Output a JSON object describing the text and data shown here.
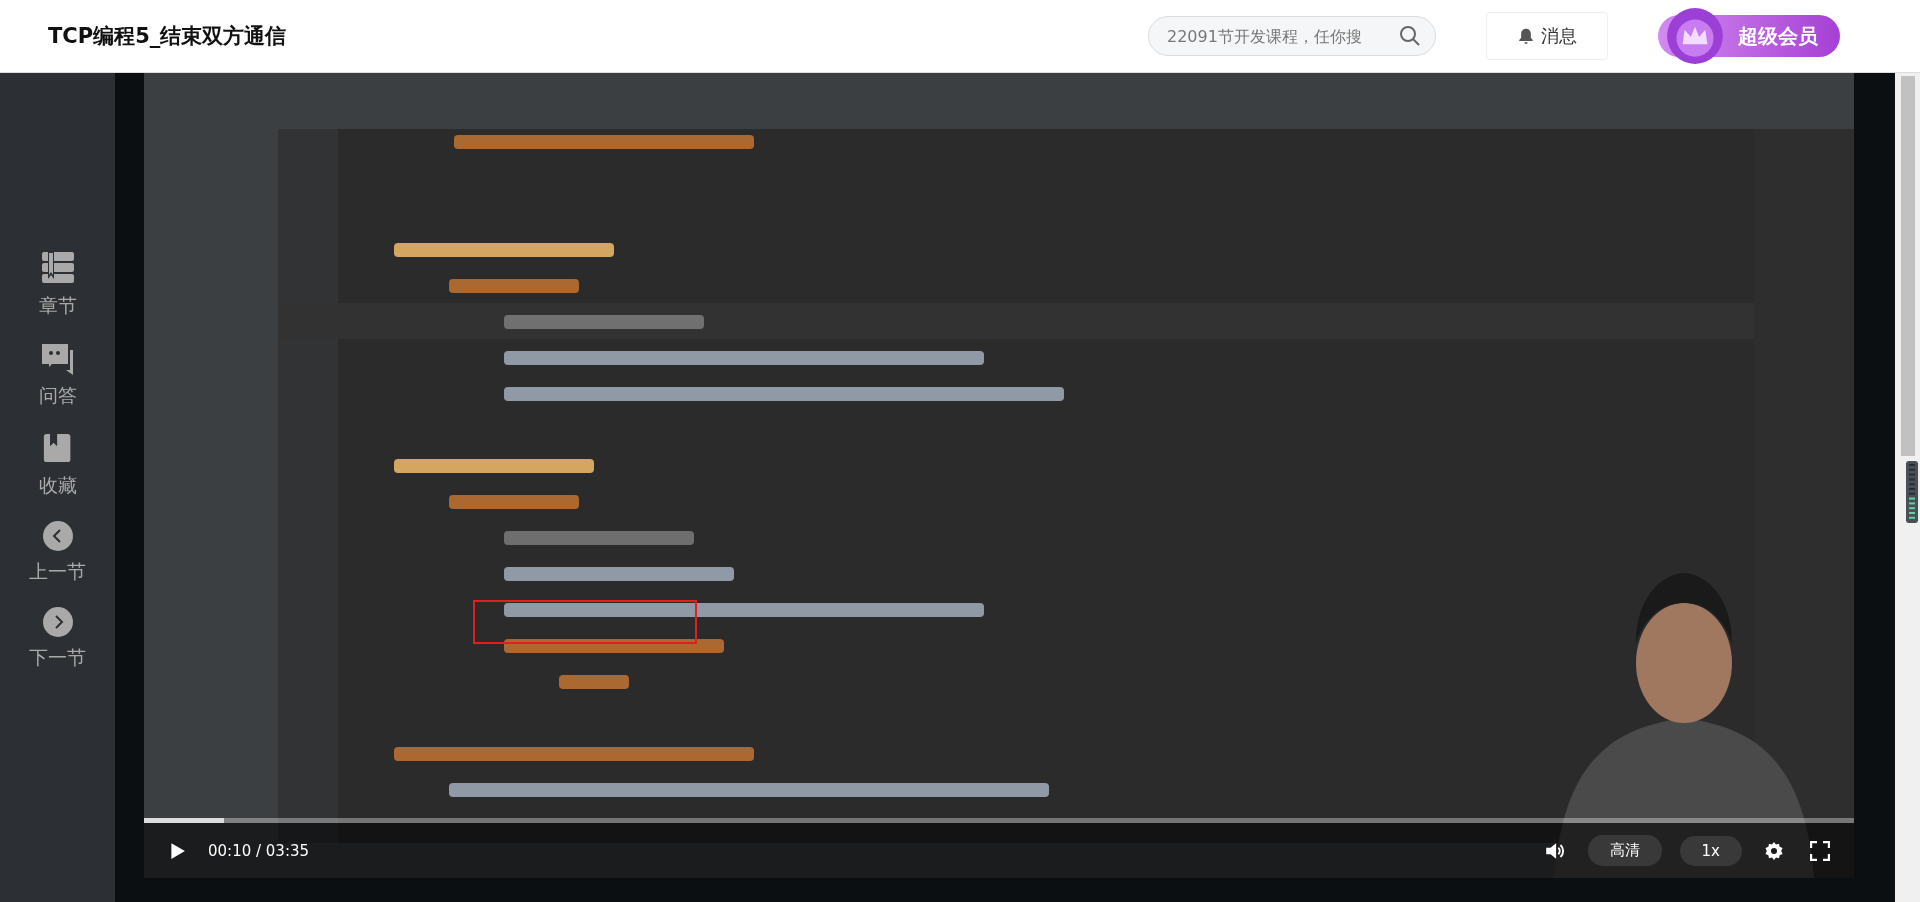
{
  "header": {
    "title": "TCP编程5_结束双方通信",
    "search": {
      "placeholder": "22091节开发课程，任你搜"
    },
    "messages": "消息",
    "vip": "超级会员"
  },
  "sidebar": {
    "items": [
      {
        "kind": "chapters",
        "label": "章节"
      },
      {
        "kind": "qa",
        "label": "问答"
      },
      {
        "kind": "favorite",
        "label": "收藏"
      },
      {
        "kind": "prev",
        "label": "上一节"
      },
      {
        "kind": "next",
        "label": "下一节"
      }
    ]
  },
  "player": {
    "progress": {
      "level": 0.047
    },
    "time": "00:10 / 03:35",
    "quality": "高清",
    "speed": "1x"
  }
}
